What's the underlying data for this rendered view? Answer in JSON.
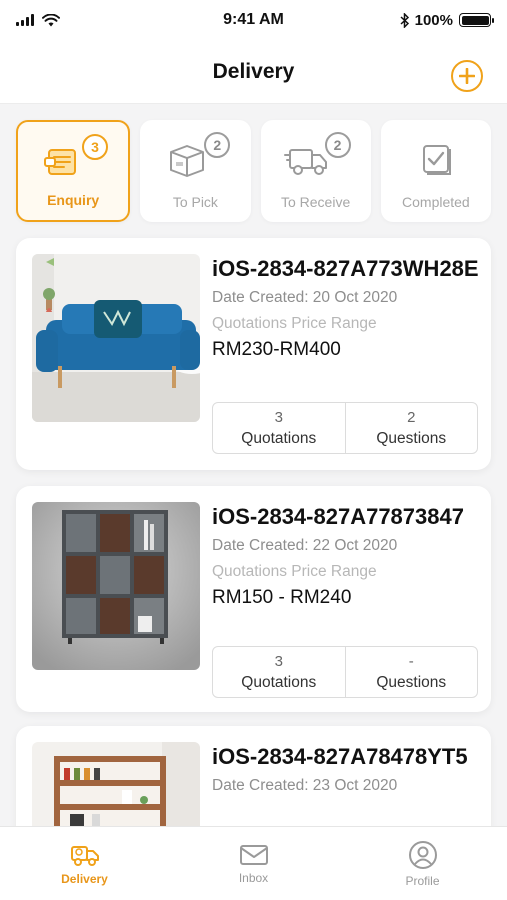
{
  "status_bar": {
    "time": "9:41 AM",
    "battery": "100%"
  },
  "header": {
    "title": "Delivery",
    "add_icon": "plus-circle-icon",
    "accent": "#f0a21a"
  },
  "tabs": [
    {
      "label": "Enquiry",
      "badge": "3",
      "icon": "enquiry-icon",
      "active": true
    },
    {
      "label": "To Pick",
      "badge": "2",
      "icon": "box-icon",
      "active": false
    },
    {
      "label": "To Receive",
      "badge": "2",
      "icon": "truck-icon",
      "active": false
    },
    {
      "label": "Completed",
      "badge": "",
      "icon": "checklist-icon",
      "active": false
    }
  ],
  "cards": [
    {
      "id": "iOS-2834-827A773WH28E",
      "date": "Date Created: 20 Oct 2020",
      "range_label": "Quotations Price Range",
      "range": "RM230-RM400",
      "quotations_count": "3",
      "quotations_label": "Quotations",
      "questions_count": "2",
      "questions_label": "Questions",
      "image": "blue-sofa-image"
    },
    {
      "id": "iOS-2834-827A77873847",
      "date": "Date Created: 22 Oct 2020",
      "range_label": "Quotations Price Range",
      "range": "RM150 - RM240",
      "quotations_count": "3",
      "quotations_label": "Quotations",
      "questions_count": "-",
      "questions_label": "Questions",
      "image": "bookshelf-image"
    },
    {
      "id": "iOS-2834-827A78478YT5",
      "date": "Date Created: 23 Oct 2020",
      "image": "kitchen-shelf-image"
    }
  ],
  "bottom_nav": [
    {
      "label": "Delivery",
      "icon": "delivery-truck-icon",
      "active": true
    },
    {
      "label": "Inbox",
      "icon": "mail-icon",
      "active": false
    },
    {
      "label": "Profile",
      "icon": "profile-icon",
      "active": false
    }
  ]
}
